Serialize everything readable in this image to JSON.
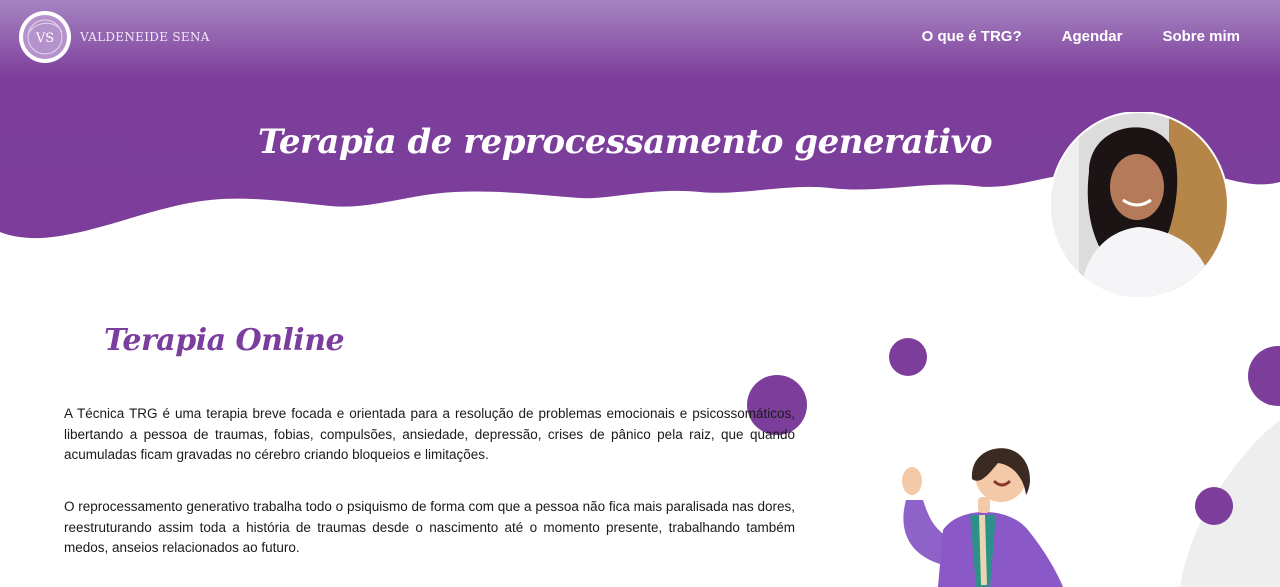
{
  "brand": {
    "initials": "VS",
    "name": "VALDENEIDE SENA"
  },
  "nav": {
    "items": [
      {
        "label": "O que é TRG?"
      },
      {
        "label": "Agendar"
      },
      {
        "label": "Sobre mim"
      }
    ]
  },
  "hero": {
    "title": "Terapia de reprocessamento generativo"
  },
  "main": {
    "title": "Terapia Online",
    "paragraphs": [
      "A Técnica TRG é uma terapia breve focada e orientada para a resolução de problemas emocionais e psicossomáticos, libertando a pessoa de traumas, fobias, compulsões, ansiedade, depressão, crises de pânico pela raiz, que quando acumuladas ficam gravadas no cérebro criando bloqueios e limitações.",
      "O reprocessamento generativo trabalha todo o psiquismo de forma com que a pessoa não fica mais paralisada nas dores, reestruturando assim toda a história de traumas desde o nascimento até o momento presente, trabalhando também medos, anseios relacionados ao futuro."
    ]
  },
  "colors": {
    "primary": "#7c3d9b",
    "header_top": "#a580c0",
    "accent": "#8e44ad",
    "white": "#ffffff"
  }
}
